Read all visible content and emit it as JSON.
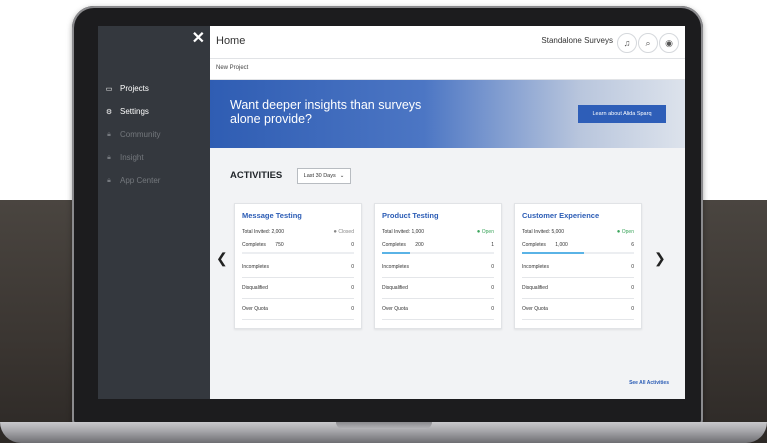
{
  "sidebar": {
    "items": [
      {
        "label": "Projects",
        "icon": "folder-icon",
        "enabled": true
      },
      {
        "label": "Settings",
        "icon": "gear-icon",
        "enabled": true
      },
      {
        "label": "Community",
        "icon": "lock-icon",
        "enabled": false
      },
      {
        "label": "Insight",
        "icon": "lock-icon",
        "enabled": false
      },
      {
        "label": "App Center",
        "icon": "lock-icon",
        "enabled": false
      }
    ]
  },
  "header": {
    "title": "Home",
    "org": "Standalone Surveys",
    "icons": [
      "bell-icon",
      "search-icon",
      "user-icon"
    ]
  },
  "subheader": {
    "new_project": "New Project"
  },
  "banner": {
    "text": "Want deeper insights than surveys alone provide?",
    "button": "Learn about Alida Sparq"
  },
  "activities": {
    "title": "ACTIVITIES",
    "period": "Last 30 Days",
    "see_all": "See All Activities",
    "cards": [
      {
        "title": "Message Testing",
        "invited_label": "Total Invited:",
        "invited": "2,000",
        "status": "Closed",
        "completes_label": "Completes",
        "completes": "750",
        "completes_right": "0",
        "progress": 0.0,
        "rows": [
          {
            "label": "Incompletes",
            "value": "0"
          },
          {
            "label": "Disqualified",
            "value": "0"
          },
          {
            "label": "Over Quota",
            "value": "0"
          }
        ]
      },
      {
        "title": "Product Testing",
        "invited_label": "Total Invited:",
        "invited": "1,000",
        "status": "Open",
        "completes_label": "Completes",
        "completes": "200",
        "completes_right": "1",
        "progress": 0.25,
        "rows": [
          {
            "label": "Incompletes",
            "value": "0"
          },
          {
            "label": "Disqualified",
            "value": "0"
          },
          {
            "label": "Over Quota",
            "value": "0"
          }
        ]
      },
      {
        "title": "Customer Experience",
        "invited_label": "Total Invited:",
        "invited": "5,000",
        "status": "Open",
        "completes_label": "Completes",
        "completes": "1,000",
        "completes_right": "6",
        "progress": 0.55,
        "rows": [
          {
            "label": "Incompletes",
            "value": "0"
          },
          {
            "label": "Disqualified",
            "value": "0"
          },
          {
            "label": "Over Quota",
            "value": "0"
          }
        ]
      }
    ]
  },
  "colors": {
    "accent": "#2b5cb5",
    "open": "#3ba55c",
    "closed": "#888888",
    "sidebar": "#34383e",
    "progress": "#5ab3e6"
  }
}
